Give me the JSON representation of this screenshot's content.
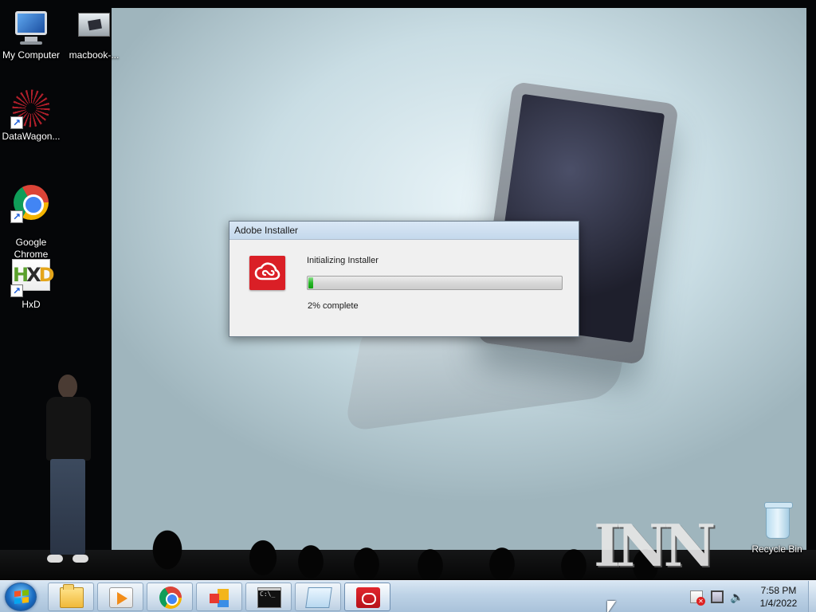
{
  "desktop": {
    "icons": [
      {
        "label": "My Computer",
        "icon": "computer-icon"
      },
      {
        "label": "macbook-...",
        "icon": "image-file-icon"
      },
      {
        "label": "DataWagon...",
        "icon": "datawagon-icon"
      },
      {
        "label": "Google\nChrome",
        "icon": "chrome-icon"
      },
      {
        "label": "HxD",
        "icon": "hxd-icon"
      },
      {
        "label": "Recycle Bin",
        "icon": "recycle-bin-icon"
      }
    ],
    "watermark_text": "INN"
  },
  "installer": {
    "title": "Adobe Installer",
    "status": "Initializing Installer",
    "progress_percent": 2,
    "progress_text": "2% complete",
    "logo_color": "#da1f26"
  },
  "taskbar": {
    "apps": [
      {
        "name": "windows-explorer",
        "icon": "folder-icon"
      },
      {
        "name": "media-player",
        "icon": "media-player-icon"
      },
      {
        "name": "google-chrome",
        "icon": "chrome-icon"
      },
      {
        "name": "control-panel",
        "icon": "tiles-icon"
      },
      {
        "name": "command-prompt",
        "icon": "cmd-icon",
        "glyph": "C:\\_"
      },
      {
        "name": "notepad",
        "icon": "notepad-icon"
      },
      {
        "name": "adobe-installer",
        "icon": "creative-cloud-icon",
        "active": true
      }
    ],
    "clock": {
      "time": "7:58 PM",
      "date": "1/4/2022"
    },
    "tray_icons": [
      "action-center-flag-icon",
      "network-icon",
      "volume-icon"
    ]
  }
}
